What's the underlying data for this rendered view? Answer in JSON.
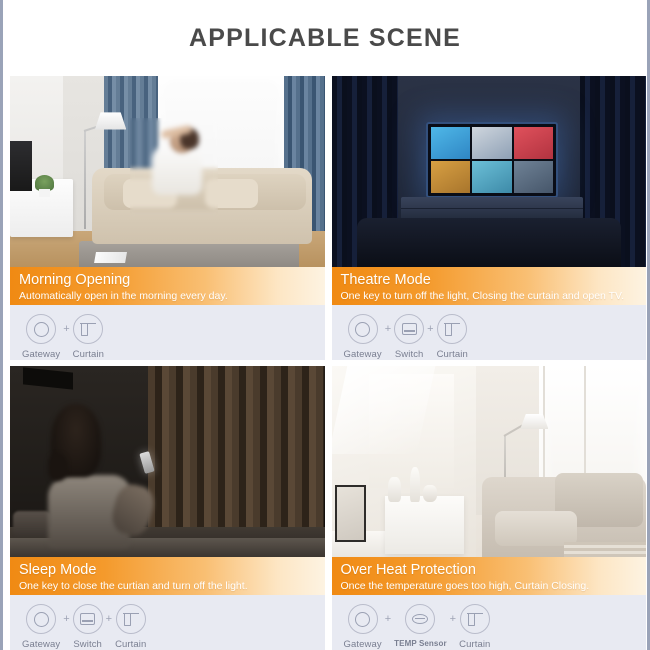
{
  "header": {
    "title": "APPLICABLE SCENE"
  },
  "colors": {
    "accent_orange": "#F08A13",
    "caption_text": "#FFFFFF",
    "device_row_bg": "#E8EAF2",
    "device_label": "#7A7F91",
    "title_text": "#4A4A4A",
    "page_border": "#9AA3B8"
  },
  "cards": [
    {
      "scene": "bright-living-room",
      "title": "Morning Opening",
      "subtitle": "Automatically open in the morning every day.",
      "devices": [
        {
          "icon": "gateway-icon",
          "label": "Gateway"
        },
        {
          "icon": "curtain-icon",
          "label": "Curtain"
        }
      ],
      "separator": "+"
    },
    {
      "scene": "dark-theatre-room",
      "title": "Theatre Mode",
      "subtitle": "One key to turn off the light, Closing the curtain and open TV.",
      "devices": [
        {
          "icon": "gateway-icon",
          "label": "Gateway"
        },
        {
          "icon": "switch-icon",
          "label": "Switch"
        },
        {
          "icon": "curtain-icon",
          "label": "Curtain"
        }
      ],
      "separator": "+"
    },
    {
      "scene": "dark-bedroom-night",
      "title": "Sleep Mode",
      "subtitle": "One key to close the curtian and turn off the light.",
      "devices": [
        {
          "icon": "gateway-icon",
          "label": "Gateway"
        },
        {
          "icon": "switch-icon",
          "label": "Switch"
        },
        {
          "icon": "curtain-icon",
          "label": "Curtain"
        }
      ],
      "separator": "+"
    },
    {
      "scene": "bright-sunlit-room",
      "title": "Over Heat Protection",
      "subtitle": "Once the temperature goes too high, Curtain Closing.",
      "devices": [
        {
          "icon": "gateway-icon",
          "label": "Gateway"
        },
        {
          "icon": "temp-sensor-icon",
          "label": "TEMP Sensor"
        },
        {
          "icon": "curtain-icon",
          "label": "Curtain"
        }
      ],
      "separator": "+"
    }
  ]
}
